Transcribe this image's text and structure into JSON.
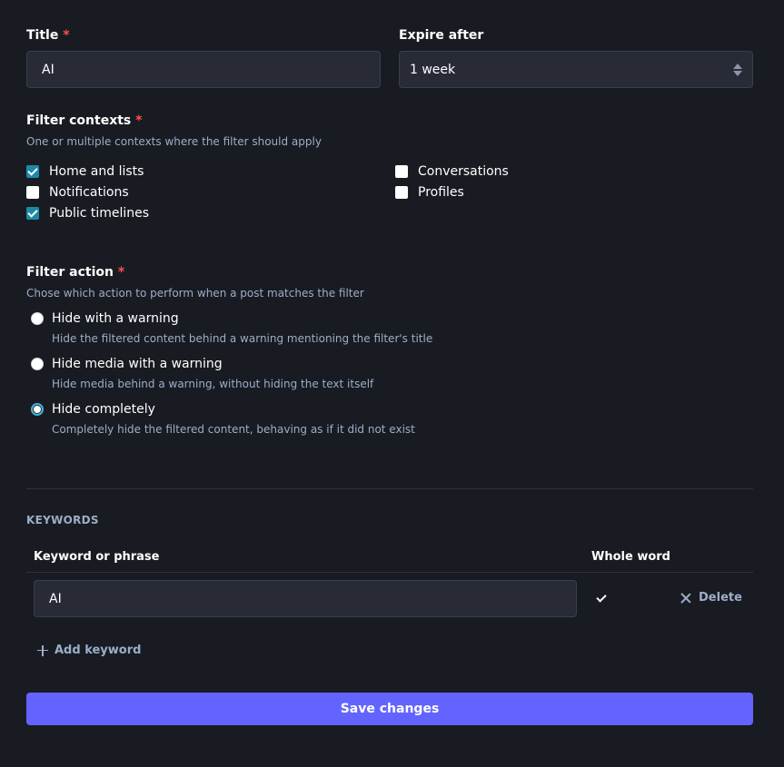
{
  "title_field": {
    "label": "Title",
    "required_mark": "*",
    "value": "AI"
  },
  "expire_field": {
    "label": "Expire after",
    "value": "1 week"
  },
  "contexts": {
    "label": "Filter contexts",
    "required_mark": "*",
    "hint": "One or multiple contexts where the filter should apply",
    "items": [
      {
        "label": "Home and lists",
        "checked": true
      },
      {
        "label": "Notifications",
        "checked": false
      },
      {
        "label": "Public timelines",
        "checked": true
      },
      {
        "label": "Conversations",
        "checked": false
      },
      {
        "label": "Profiles",
        "checked": false
      }
    ]
  },
  "action": {
    "label": "Filter action",
    "required_mark": "*",
    "hint": "Chose which action to perform when a post matches the filter",
    "options": [
      {
        "label": "Hide with a warning",
        "desc": "Hide the filtered content behind a warning mentioning the filter's title",
        "selected": false
      },
      {
        "label": "Hide media with a warning",
        "desc": "Hide media behind a warning, without hiding the text itself",
        "selected": false
      },
      {
        "label": "Hide completely",
        "desc": "Completely hide the filtered content, behaving as if it did not exist",
        "selected": true
      }
    ]
  },
  "keywords": {
    "section_title": "KEYWORDS",
    "col_keyword": "Keyword or phrase",
    "col_whole_word": "Whole word",
    "rows": [
      {
        "keyword": "AI",
        "whole_word": true,
        "delete_label": "Delete"
      }
    ],
    "add_label": "Add keyword"
  },
  "save_label": "Save changes",
  "colors": {
    "accent": "#6364ff",
    "checkbox": "#1c8aa6",
    "background": "#191b22",
    "input": "#282a36",
    "required": "#ff5050"
  }
}
